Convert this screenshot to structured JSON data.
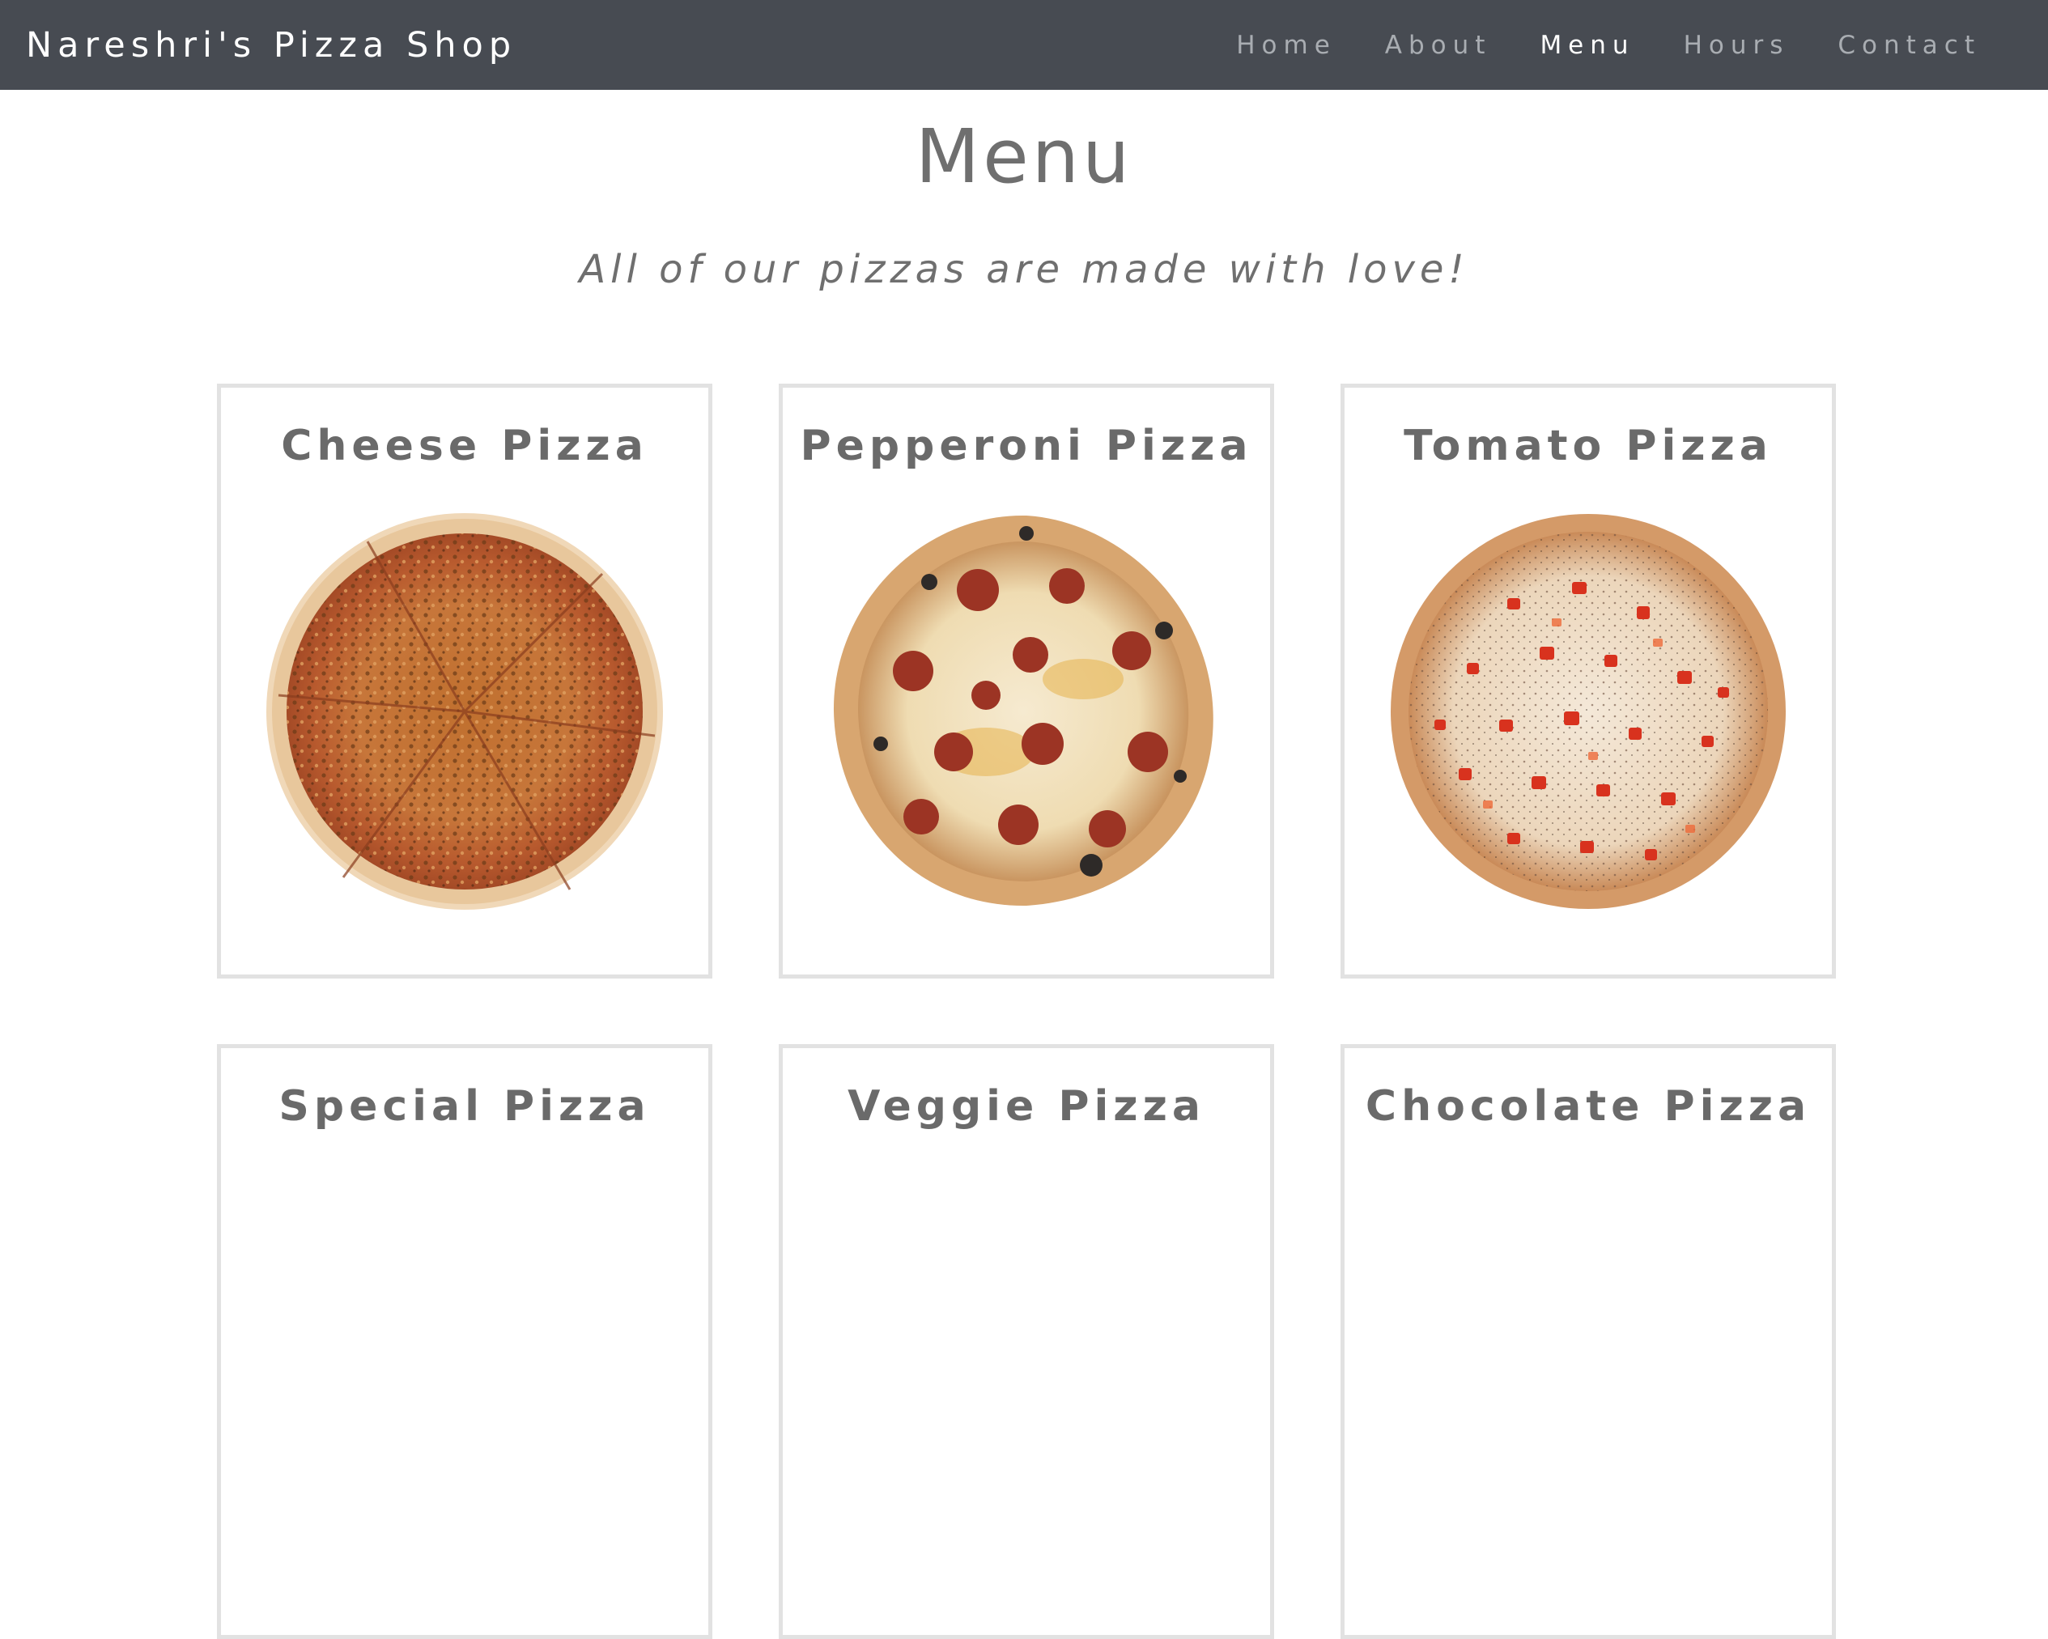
{
  "nav": {
    "brand": "Nareshri's Pizza Shop",
    "links": [
      {
        "label": "Home",
        "active": false
      },
      {
        "label": "About",
        "active": false
      },
      {
        "label": "Menu",
        "active": true
      },
      {
        "label": "Hours",
        "active": false
      },
      {
        "label": "Contact",
        "active": false
      }
    ]
  },
  "page": {
    "title": "Menu",
    "tagline": "All of our pizzas are made with love!"
  },
  "menu": {
    "items": [
      {
        "name": "Cheese Pizza",
        "image": "cheese-pizza-image"
      },
      {
        "name": "Pepperoni Pizza",
        "image": "pepperoni-pizza-image"
      },
      {
        "name": "Tomato Pizza",
        "image": "tomato-pizza-image"
      },
      {
        "name": "Special Pizza"
      },
      {
        "name": "Veggie Pizza"
      },
      {
        "name": "Chocolate Pizza"
      }
    ]
  },
  "colors": {
    "navbar": "#474b52",
    "nav_active": "#ffffff",
    "nav_inactive": "#a9adb2",
    "heading_text": "#6f6f6f",
    "card_border": "#e2e2e2"
  }
}
